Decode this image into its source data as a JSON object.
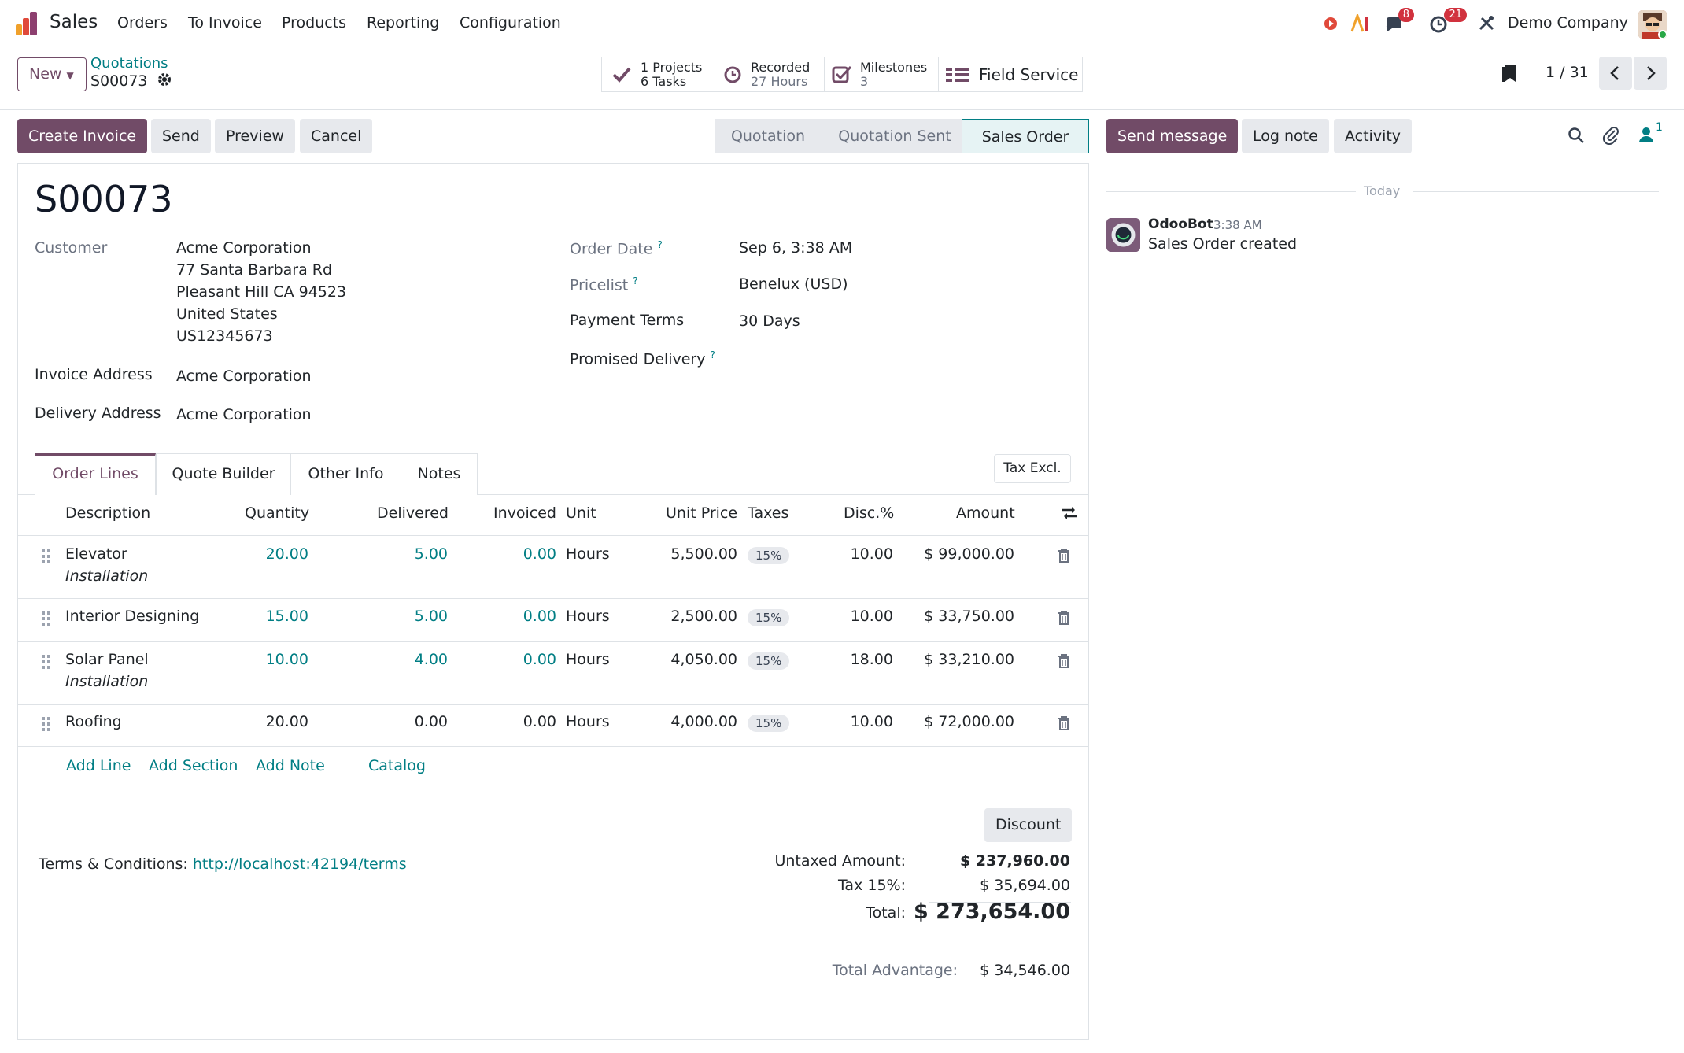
{
  "nav": {
    "app_name": "Sales",
    "menu": [
      "Orders",
      "To Invoice",
      "Products",
      "Reporting",
      "Configuration"
    ],
    "messages_badge": "8",
    "activities_badge": "21",
    "company": "Demo Company"
  },
  "control_panel": {
    "new_label": "New",
    "breadcrumb_parent": "Quotations",
    "breadcrumb_current": "S00073",
    "smart_buttons": {
      "projects_count": "1",
      "projects_label": "Projects",
      "tasks_count": "6",
      "tasks_label": "Tasks",
      "recorded_label": "Recorded",
      "recorded_value": "27 Hours",
      "milestones_label": "Milestones",
      "milestones_value": "3",
      "field_service_label": "Field Service"
    },
    "pager": "1 / 31"
  },
  "actions": {
    "create_invoice": "Create Invoice",
    "send": "Send",
    "preview": "Preview",
    "cancel": "Cancel"
  },
  "status": {
    "stages": [
      "Quotation",
      "Quotation Sent",
      "Sales Order"
    ],
    "active": "Sales Order"
  },
  "form": {
    "order_name": "S00073",
    "customer_label": "Customer",
    "customer_name": "Acme Corporation",
    "customer_address": [
      "77 Santa Barbara Rd",
      "Pleasant Hill CA 94523",
      "United States",
      "US12345673"
    ],
    "invoice_address_label": "Invoice Address",
    "invoice_address": "Acme Corporation",
    "delivery_address_label": "Delivery Address",
    "delivery_address": "Acme Corporation",
    "order_date_label": "Order Date",
    "order_date": "Sep 6, 3:38 AM",
    "pricelist_label": "Pricelist",
    "pricelist": "Benelux (USD)",
    "payment_terms_label": "Payment Terms",
    "payment_terms": "30 Days",
    "promised_delivery_label": "Promised Delivery",
    "help_mark": "?"
  },
  "tabs": [
    "Order Lines",
    "Quote Builder",
    "Other Info",
    "Notes"
  ],
  "tax_excl": "Tax Excl.",
  "table": {
    "headers": {
      "description": "Description",
      "quantity": "Quantity",
      "delivered": "Delivered",
      "invoiced": "Invoiced",
      "unit": "Unit",
      "unit_price": "Unit Price",
      "taxes": "Taxes",
      "disc": "Disc.%",
      "amount": "Amount"
    },
    "rows": [
      {
        "desc": "Elevator",
        "sub": "Installation",
        "qty": "20.00",
        "delivered": "5.00",
        "invoiced": "0.00",
        "unit": "Hours",
        "price": "5,500.00",
        "tax": "15%",
        "disc": "10.00",
        "amount": "$ 99,000.00"
      },
      {
        "desc": "Interior Designing",
        "sub": "",
        "qty": "15.00",
        "delivered": "5.00",
        "invoiced": "0.00",
        "unit": "Hours",
        "price": "2,500.00",
        "tax": "15%",
        "disc": "10.00",
        "amount": "$ 33,750.00"
      },
      {
        "desc": "Solar Panel",
        "sub": "Installation",
        "qty": "10.00",
        "delivered": "4.00",
        "invoiced": "0.00",
        "unit": "Hours",
        "price": "4,050.00",
        "tax": "15%",
        "disc": "18.00",
        "amount": "$ 33,210.00"
      },
      {
        "desc": "Roofing",
        "sub": "",
        "qty": "20.00",
        "delivered": "0.00",
        "invoiced": "0.00",
        "unit": "Hours",
        "price": "4,000.00",
        "tax": "15%",
        "disc": "10.00",
        "amount": "$ 72,000.00"
      }
    ],
    "add_line": "Add Line",
    "add_section": "Add Section",
    "add_note": "Add Note",
    "catalog": "Catalog"
  },
  "totals": {
    "discount_button": "Discount",
    "terms_label": "Terms & Conditions:",
    "terms_link": "http://localhost:42194/terms",
    "untaxed_label": "Untaxed Amount:",
    "untaxed": "$ 237,960.00",
    "tax_label": "Tax 15%:",
    "tax": "$ 35,694.00",
    "total_label": "Total:",
    "total": "$ 273,654.00",
    "advantage_label": "Total Advantage:",
    "advantage": "$ 34,546.00"
  },
  "chatter": {
    "send_message": "Send message",
    "log_note": "Log note",
    "activity": "Activity",
    "followers_count": "1",
    "today": "Today",
    "author": "OdooBot",
    "time": "3:38 AM",
    "message": "Sales Order created"
  },
  "colors": {
    "brand": "#714b67",
    "link": "#017e84",
    "badge": "#d1323e"
  }
}
